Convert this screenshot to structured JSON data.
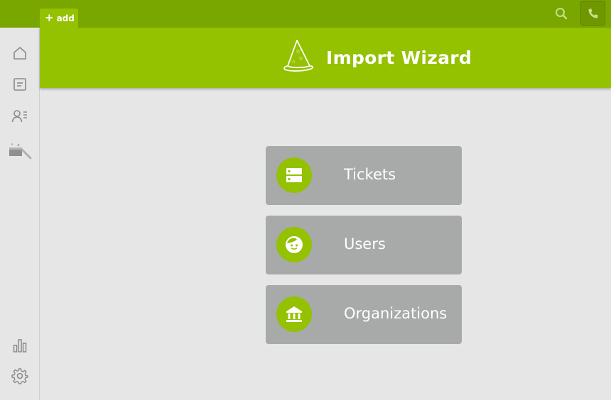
{
  "topbar": {
    "add_label": "add",
    "icons": [
      "plus-icon",
      "search-icon",
      "phone-icon"
    ],
    "accent": "#7aa600"
  },
  "sidebar": {
    "items": [
      {
        "name": "home",
        "icon": "home-icon"
      },
      {
        "name": "tickets",
        "icon": "ticket-list-icon"
      },
      {
        "name": "users",
        "icon": "users-list-icon"
      },
      {
        "name": "import",
        "icon": "import-wizard-icon"
      },
      {
        "name": "reports",
        "icon": "bar-chart-icon"
      },
      {
        "name": "settings",
        "icon": "gear-icon"
      }
    ]
  },
  "header": {
    "title": "Import Wizard",
    "icon": "wizard-hat-icon",
    "color": "#94c100"
  },
  "options": [
    {
      "label": "Tickets",
      "icon": "server-icon"
    },
    {
      "label": "Users",
      "icon": "face-icon"
    },
    {
      "label": "Organizations",
      "icon": "bank-icon"
    }
  ],
  "colors": {
    "option_bg": "#a7aaa9",
    "circle": "#94c100"
  }
}
